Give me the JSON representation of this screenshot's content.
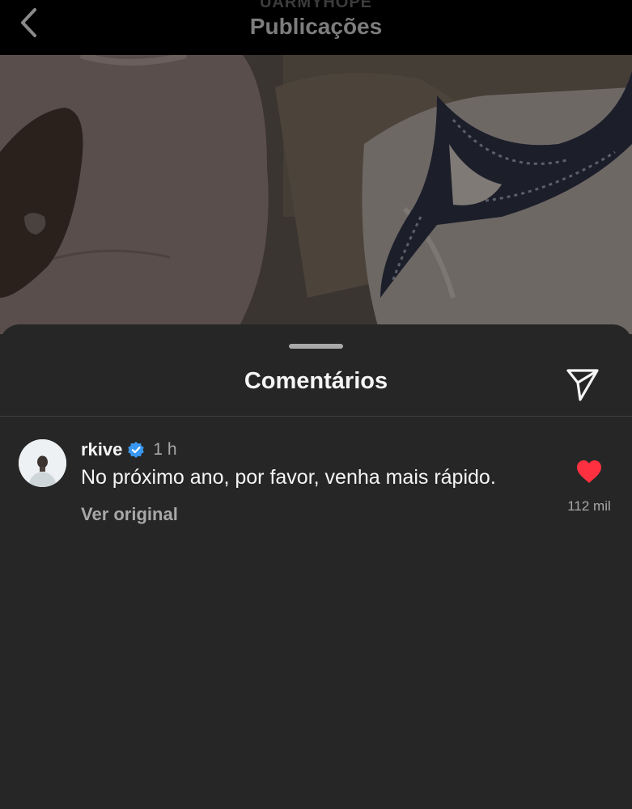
{
  "header": {
    "username": "UARMYHOPE",
    "title": "Publicações",
    "back_icon": "chevron-left-icon"
  },
  "sheet": {
    "title": "Comentários",
    "share_icon": "send-icon"
  },
  "comment": {
    "username": "rkive",
    "verified": true,
    "verified_color": "#3897f0",
    "time": "1 h",
    "text": "No próximo ano, por favor, venha mais rápido.",
    "translate_label": "Ver original",
    "liked": true,
    "like_color": "#ff3040",
    "like_count": "112 mil"
  },
  "colors": {
    "sheet_background": "#262626",
    "header_background": "#000000"
  }
}
